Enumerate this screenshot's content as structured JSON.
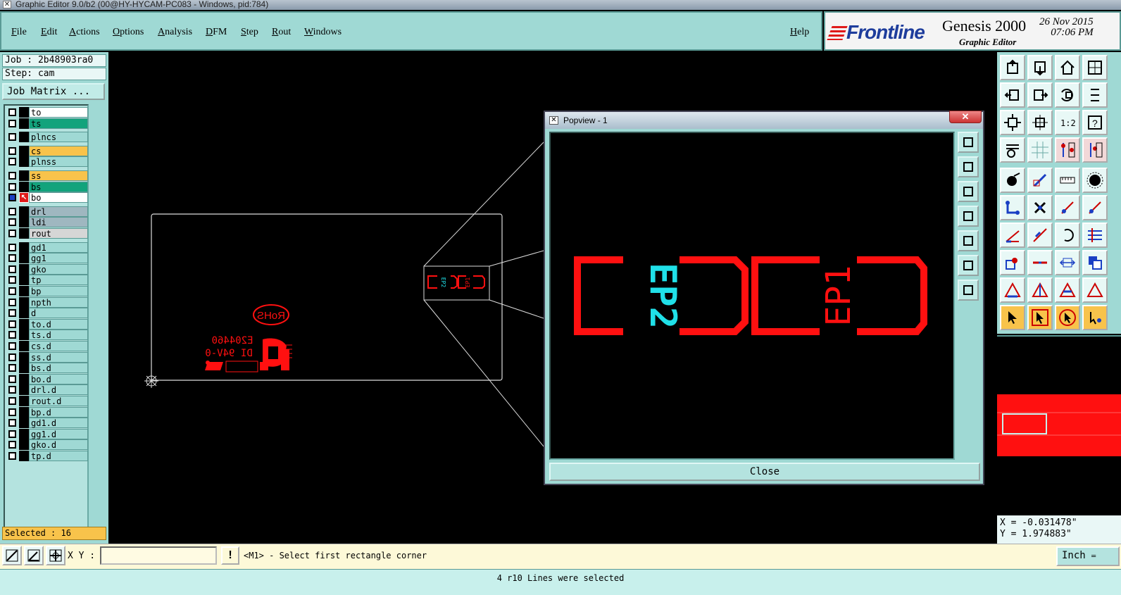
{
  "window": {
    "title": "Graphic Editor 9.0/b2 (00@HY-HYCAM-PC083 - Windows, pid:784)"
  },
  "menu": {
    "items": [
      "File",
      "Edit",
      "Actions",
      "Options",
      "Analysis",
      "DFM",
      "Step",
      "Rout",
      "Windows"
    ],
    "help": "Help"
  },
  "brand": {
    "logo": "Frontline",
    "product": "Genesis 2000",
    "subtitle": "Graphic Editor",
    "date": "26 Nov 2015",
    "time": "07:06 PM"
  },
  "job": {
    "job_label": "Job : 2b48903ra0",
    "step_label": "Step: cam",
    "matrix_button": "Job Matrix ..."
  },
  "layers": [
    {
      "name": "to",
      "color": "#ffffff"
    },
    {
      "name": "ts",
      "color": "#12a37c"
    },
    {
      "name": "plncs",
      "color": "#9fd9d4"
    },
    {
      "name": "cs",
      "color": "#f8c34b"
    },
    {
      "name": "plnss",
      "color": "#9fd9d4"
    },
    {
      "name": "ss",
      "color": "#f8c34b"
    },
    {
      "name": "bs",
      "color": "#12a37c"
    },
    {
      "name": "bo",
      "color": "#ffffff",
      "active": true
    },
    {
      "name": "drl",
      "color": "#9fb7c0"
    },
    {
      "name": "ldi",
      "color": "#9fb7c0"
    },
    {
      "name": "rout",
      "color": "#d6d6d6"
    },
    {
      "name": "gd1",
      "color": "#9fd9d4"
    },
    {
      "name": "gg1",
      "color": "#9fd9d4"
    },
    {
      "name": "gko",
      "color": "#9fd9d4"
    },
    {
      "name": "tp",
      "color": "#9fd9d4"
    },
    {
      "name": "bp",
      "color": "#9fd9d4"
    },
    {
      "name": "npth",
      "color": "#9fd9d4"
    },
    {
      "name": "d",
      "color": "#9fd9d4"
    },
    {
      "name": "to.d",
      "color": "#9fd9d4"
    },
    {
      "name": "ts.d",
      "color": "#9fd9d4"
    },
    {
      "name": "cs.d",
      "color": "#9fd9d4"
    },
    {
      "name": "ss.d",
      "color": "#9fd9d4"
    },
    {
      "name": "bs.d",
      "color": "#9fd9d4"
    },
    {
      "name": "bo.d",
      "color": "#9fd9d4"
    },
    {
      "name": "drl.d",
      "color": "#9fd9d4"
    },
    {
      "name": "rout.d",
      "color": "#9fd9d4"
    },
    {
      "name": "bp.d",
      "color": "#9fd9d4"
    },
    {
      "name": "gd1.d",
      "color": "#9fd9d4"
    },
    {
      "name": "gg1.d",
      "color": "#9fd9d4"
    },
    {
      "name": "gko.d",
      "color": "#9fd9d4"
    },
    {
      "name": "tp.d",
      "color": "#9fd9d4"
    }
  ],
  "selection": {
    "label": "Selected : 16"
  },
  "canvas": {
    "rohs_text": "RoHS",
    "ul_text": "E204460",
    "rating_text": "DI 94V-0",
    "pad_label_1": "EP2",
    "pad_label_2": "EP1"
  },
  "popview": {
    "title": "Popview - 1",
    "close_label": "Close",
    "label_cyan": "EP2",
    "label_red": "EP1"
  },
  "coords": {
    "x": "X = -0.031478\"",
    "y": "Y = 1.974883\""
  },
  "bottom": {
    "xy_label": "X Y :",
    "xy_value": "",
    "warn": "!",
    "hint": "<M1> - Select first rectangle corner",
    "units": "Inch"
  },
  "status": {
    "message": "4 r10 Lines were selected"
  },
  "colors": {
    "panel": "#9fd9d4",
    "accent": "#f8c34b",
    "feature_red": "#ff1010",
    "feature_cyan": "#20e0e8"
  }
}
